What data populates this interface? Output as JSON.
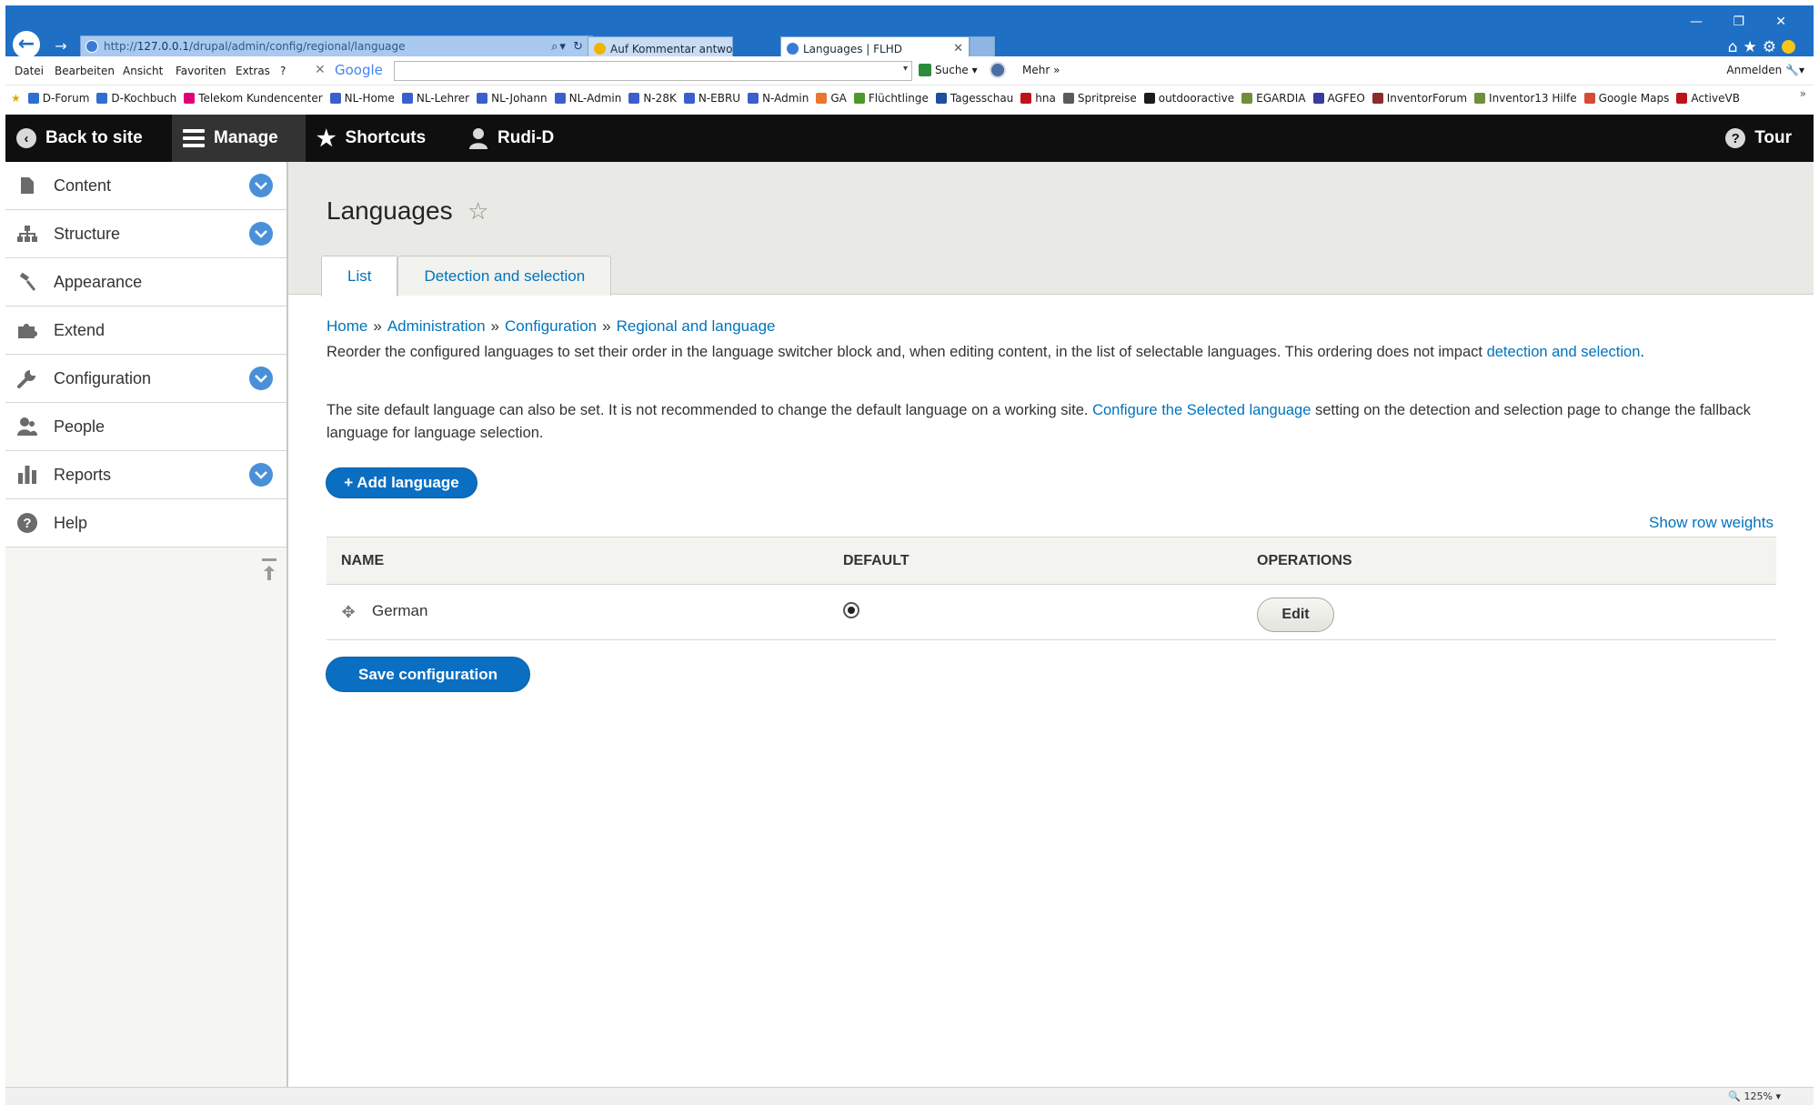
{
  "browser": {
    "url_prefix": "http://",
    "url_host": "127.0.0.1",
    "url_path": "/drupal/admin/config/regional/language",
    "tabs": [
      {
        "title": "Auf Kommentar antworten | Dr..."
      },
      {
        "title": "Languages | FLHD"
      }
    ],
    "menu": [
      "Datei",
      "Bearbeiten",
      "Ansicht",
      "Favoriten",
      "Extras",
      "?"
    ],
    "google_label": "Google",
    "search_label": "Suche",
    "more_label": "Mehr »",
    "signin_label": "Anmelden",
    "favorites": [
      "D-Forum",
      "D-Kochbuch",
      "Telekom Kundencenter",
      "NL-Home",
      "NL-Lehrer",
      "NL-Johann",
      "NL-Admin",
      "N-28K",
      "N-EBRU",
      "N-Admin",
      "GA",
      "Flüchtlinge",
      "Tagesschau",
      "hna",
      "Spritpreise",
      "outdooractive",
      "EGARDIA",
      "AGFEO",
      "InventorForum",
      "Inventor13 Hilfe",
      "Google Maps",
      "ActiveVB"
    ],
    "favorite_colors": [
      "#2e6fd0",
      "#2e6fd0",
      "#e2007a",
      "#3a5fcd",
      "#3a5fcd",
      "#3a5fcd",
      "#3a5fcd",
      "#3a5fcd",
      "#3a5fcd",
      "#3a5fcd",
      "#e8772e",
      "#4a9a2a",
      "#1c4f9c",
      "#c0121b",
      "#5a5a5a",
      "#1b1b1b",
      "#6f8f3a",
      "#3a3aa0",
      "#8a2c2c",
      "#6f8f3a",
      "#d84a38",
      "#c0121b"
    ],
    "zoom": "125%"
  },
  "toolbar": {
    "back_to_site": "Back to site",
    "manage": "Manage",
    "shortcuts": "Shortcuts",
    "user": "Rudi-D",
    "tour": "Tour"
  },
  "sidebar": {
    "items": [
      {
        "label": "Content",
        "icon": "file-icon",
        "expandable": true
      },
      {
        "label": "Structure",
        "icon": "sitemap-icon",
        "expandable": true
      },
      {
        "label": "Appearance",
        "icon": "paint-icon",
        "expandable": false
      },
      {
        "label": "Extend",
        "icon": "puzzle-icon",
        "expandable": false
      },
      {
        "label": "Configuration",
        "icon": "wrench-icon",
        "expandable": true
      },
      {
        "label": "People",
        "icon": "people-icon",
        "expandable": false
      },
      {
        "label": "Reports",
        "icon": "chart-icon",
        "expandable": true
      },
      {
        "label": "Help",
        "icon": "help-icon",
        "expandable": false
      }
    ]
  },
  "page": {
    "title": "Languages",
    "tabs": [
      {
        "label": "List",
        "active": true
      },
      {
        "label": "Detection and selection",
        "active": false
      }
    ],
    "breadcrumb": [
      "Home",
      "Administration",
      "Configuration",
      "Regional and language"
    ],
    "breadcrumb_sep": "»",
    "desc1_before": "Reorder the configured languages to set their order in the language switcher block and, when editing content, in the list of selectable languages. This ordering does not impact ",
    "desc1_link": "detection and selection",
    "desc1_after": ".",
    "desc2_before": "The site default language can also be set. It is not recommended to change the default language on a working site. ",
    "desc2_link": "Configure the Selected language",
    "desc2_after": " setting on the detection and selection page to change the fallback language for language selection.",
    "add_language": "+ Add language",
    "show_row_weights": "Show row weights",
    "table": {
      "headers": [
        "NAME",
        "DEFAULT",
        "OPERATIONS"
      ],
      "rows": [
        {
          "name": "German",
          "default": true,
          "operation": "Edit"
        }
      ]
    },
    "save": "Save configuration"
  },
  "colors": {
    "accent": "#0074bd",
    "toolbar_bg": "#0f0f0f",
    "browser_blue": "#1f6fc5",
    "primary_button": "#0a6fc2"
  }
}
